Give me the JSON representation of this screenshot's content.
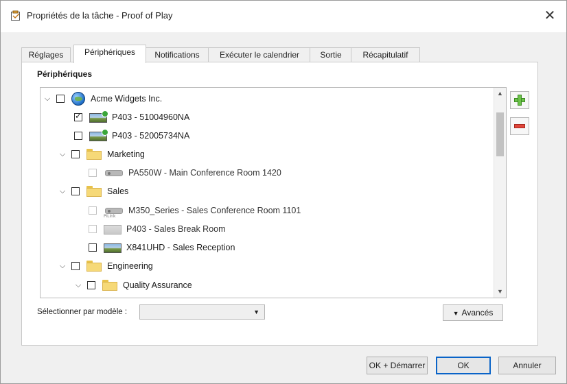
{
  "window": {
    "title": "Propriétés de la tâche - Proof of Play",
    "close_glyph": "✕"
  },
  "tabs": [
    {
      "label": "Réglages"
    },
    {
      "label": "Périphériques",
      "active": true
    },
    {
      "label": "Notifications"
    },
    {
      "label": "Exécuter le calendrier"
    },
    {
      "label": "Sortie"
    },
    {
      "label": "Récapitulatif"
    }
  ],
  "panel": {
    "section_title": "Périphériques"
  },
  "tree": [
    {
      "label": "Acme Widgets Inc.",
      "icon": "globe-icon",
      "checked": false,
      "expanded": true
    },
    {
      "label": "P403 - 51004960NA",
      "icon": "display-icon",
      "checked": true
    },
    {
      "label": "P403 - 52005734NA",
      "icon": "display-icon",
      "checked": false
    },
    {
      "label": "Marketing",
      "icon": "folder-icon",
      "checked": false,
      "expanded": true
    },
    {
      "label": "PA550W - Main Conference Room 1420",
      "icon": "projector-icon",
      "checked": false,
      "disabled": true
    },
    {
      "label": "Sales",
      "icon": "folder-icon",
      "checked": false,
      "expanded": true
    },
    {
      "label": "M350_Series - Sales Conference Room 1101",
      "icon": "projector-icon",
      "icon_caption": "PiLink",
      "checked": false,
      "disabled": true
    },
    {
      "label": "P403 - Sales Break Room",
      "icon": "display-icon",
      "checked": false,
      "disabled": true
    },
    {
      "label": "X841UHD - Sales Reception",
      "icon": "display-icon",
      "checked": false
    },
    {
      "label": "Engineering",
      "icon": "folder-icon",
      "checked": false,
      "expanded": true
    },
    {
      "label": "Quality Assurance",
      "icon": "folder-icon",
      "checked": false,
      "expanded": true
    }
  ],
  "model_filter": {
    "label": "Sélectionner par modèle :",
    "value": ""
  },
  "advanced_button": {
    "label": "Avancés"
  },
  "footer": {
    "ok_start_label": "OK + Démarrer",
    "ok_label": "OK",
    "cancel_label": "Annuler"
  },
  "colors": {
    "add": "#6cc24a",
    "remove": "#e0453a",
    "default_button_border": "#0a64c8"
  }
}
